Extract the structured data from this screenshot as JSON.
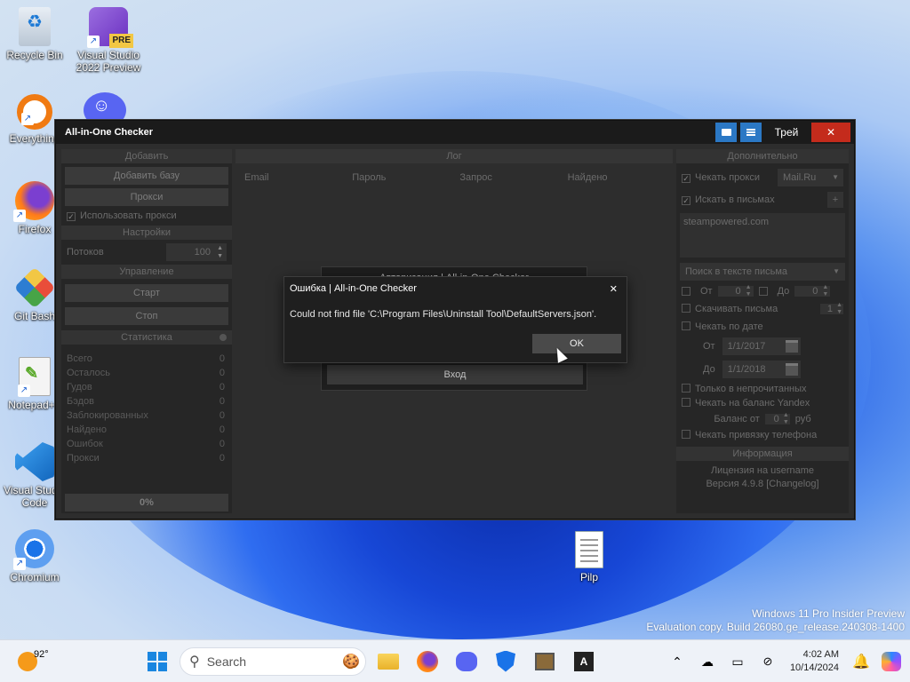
{
  "desktop": {
    "icons": [
      {
        "label": "Recycle Bin"
      },
      {
        "label": "Visual Studio 2022 Preview",
        "badge": "PRE"
      },
      {
        "label": "Everything"
      },
      {
        "label": "Firefox"
      },
      {
        "label": "Git Bash"
      },
      {
        "label": "Notepad++"
      },
      {
        "label": "Visual Studio Code"
      },
      {
        "label": "Chromium"
      },
      {
        "label": "Pilp"
      }
    ]
  },
  "window": {
    "title": "All-in-One Checker",
    "tray_label": "Трей",
    "close_glyph": "✕"
  },
  "left_panel": {
    "add_header": "Добавить",
    "add_base_button": "Добавить базу",
    "proxy_button": "Прокси",
    "use_proxy_label": "Использовать прокси",
    "settings_header": "Настройки",
    "threads_label": "Потоков",
    "threads_value": "100",
    "control_header": "Управление",
    "start_button": "Старт",
    "stop_button": "Стоп",
    "stats_header": "Статистика",
    "stats": [
      {
        "label": "Всего",
        "value": "0"
      },
      {
        "label": "Осталось",
        "value": "0"
      },
      {
        "label": "Гудов",
        "value": "0"
      },
      {
        "label": "Бэдов",
        "value": "0"
      },
      {
        "label": "Заблокированных",
        "value": "0"
      },
      {
        "label": "Найдено",
        "value": "0"
      },
      {
        "label": "Ошибок",
        "value": "0"
      },
      {
        "label": "Прокси",
        "value": "0"
      }
    ],
    "progress_text": "0%"
  },
  "center_panel": {
    "header": "Лог",
    "columns": [
      "Email",
      "Пароль",
      "Запрос",
      "Найдено"
    ]
  },
  "login_dialog": {
    "title_fragment": "Авторизация | All-in-One Checker",
    "login_button": "Вход"
  },
  "error_dialog": {
    "title": "Ошибка | All-in-One Checker",
    "message": "Could not find file 'C:\\Program Files\\Uninstall Tool\\DefaultServers.json'.",
    "ok_label": "OK",
    "close_glyph": "✕"
  },
  "right_panel": {
    "header": "Дополнительно",
    "check_proxy_label": "Чекать прокси",
    "proxy_type_value": "Mail.Ru",
    "search_in_emails_label": "Искать в письмах",
    "search_query_value": "steampowered.com",
    "search_in_text_value": "Поиск в тексте письма",
    "from_label": "От",
    "from_value": "0",
    "to_label": "До",
    "to_value": "0",
    "download_emails_label": "Скачивать письма",
    "download_emails_value": "1",
    "check_by_date_label": "Чекать по дате",
    "date_from_label": "От",
    "date_from_value": "1/1/2017",
    "date_to_label": "До",
    "date_to_value": "1/1/2018",
    "only_unread_label": "Только в непрочитанных",
    "check_yandex_balance_label": "Чекать на баланс Yandex",
    "balance_from_label": "Баланс от",
    "balance_from_value": "0",
    "balance_unit": "руб",
    "check_phone_label": "Чекать привязку телефона",
    "info_header": "Информация",
    "license_text": "Лицензия на username",
    "version_text": "Версия 4.9.8 [Changelog]"
  },
  "taskbar": {
    "weather_temp": "92°",
    "search_placeholder": "Search",
    "time": "4:02 AM",
    "date": "10/14/2024"
  },
  "watermark": {
    "line1": "Windows 11 Pro Insider Preview",
    "line2": "Evaluation copy. Build 26080.ge_release.240308-1400"
  }
}
